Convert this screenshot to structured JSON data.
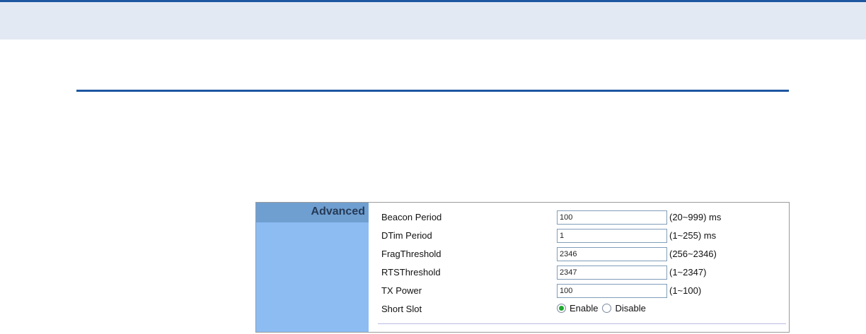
{
  "panel": {
    "title": "Advanced",
    "fields": [
      {
        "label": "Beacon Period",
        "value": "100",
        "hint": "(20~999) ms"
      },
      {
        "label": "DTim Period",
        "value": "1",
        "hint": "(1~255) ms"
      },
      {
        "label": "FragThreshold",
        "value": "2346",
        "hint": "(256~2346)"
      },
      {
        "label": "RTSThreshold",
        "value": "2347",
        "hint": "(1~2347)"
      },
      {
        "label": "TX Power",
        "value": "100",
        "hint": "(1~100)"
      }
    ],
    "short_slot": {
      "label": "Short Slot",
      "options": [
        "Enable",
        "Disable"
      ],
      "selected": "Enable"
    }
  },
  "colors": {
    "accent": "#1e56a0",
    "sidebar": "#8cbcf2",
    "sidebar_header": "#6f9fd1",
    "radio_selected": "#1fa82f"
  }
}
